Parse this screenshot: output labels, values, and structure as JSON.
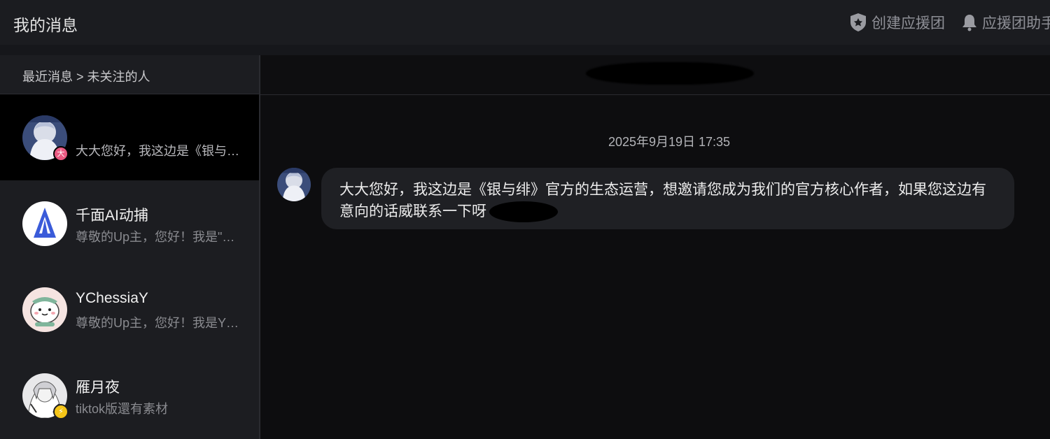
{
  "header": {
    "title": "我的消息",
    "actions": [
      {
        "label": "创建应援团",
        "icon": "shield-icon"
      },
      {
        "label": "应援团助手",
        "icon": "bell-icon"
      }
    ]
  },
  "sidebar": {
    "breadcrumb": "最近消息 > 未关注的人",
    "conversations": [
      {
        "name": "",
        "preview": "大大您好，我这边是《银与绯》官方的生态运营，想邀请您成为我们的官方核心作者",
        "badge": "大",
        "badge_color": "#ea5a82",
        "active": true
      },
      {
        "name": "千面AI动捕",
        "preview": "尊敬的Up主，您好！我是\"千面AI动捕\"",
        "badge": "",
        "active": false
      },
      {
        "name": "YChessiaY",
        "preview": "尊敬的Up主，您好！我是YChessiaY",
        "badge": "",
        "active": false
      },
      {
        "name": "雁月夜",
        "preview": "tiktok版還有素材",
        "badge": "⚡",
        "badge_color": "#f5c518",
        "active": false
      }
    ]
  },
  "chat": {
    "timestamp": "2025年9月19日 17:35",
    "message": "大大您好，我这边是《银与绯》官方的生态运营，想邀请您成为我们的官方核心作者，如果您这边有意向的话威联系一下呀"
  },
  "colors": {
    "background": "#0d0d0f",
    "sidebar": "#1c1d21",
    "bubble": "#1f2024",
    "accent_badge": "#ea5a82"
  }
}
